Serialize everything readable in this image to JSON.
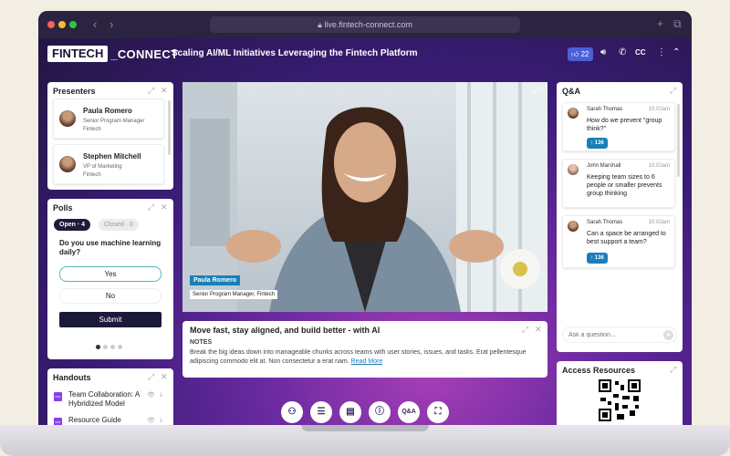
{
  "browser": {
    "url": "live.fintech-connect.com"
  },
  "header": {
    "logo_primary": "FINTECH",
    "logo_secondary": "_CONNECT",
    "session_title": "Scaling AI/ML Initiatives Leveraging the Fintech Platform",
    "likes_count": "22"
  },
  "presenters": {
    "title": "Presenters",
    "items": [
      {
        "name": "Paula Romero",
        "role_line1": "Senior Program Manager",
        "role_line2": "Fintech"
      },
      {
        "name": "Stephen Mitchell",
        "role_line1": "VP of Marketing",
        "role_line2": "Fintech"
      }
    ]
  },
  "polls": {
    "title": "Polls",
    "tab_open": "Open · 4",
    "tab_closed": "Closed · 0",
    "question": "Do you use machine learning daily?",
    "options": [
      "Yes",
      "No"
    ],
    "submit_label": "Submit"
  },
  "handouts": {
    "title": "Handouts",
    "pdf_badge": "PDF",
    "items": [
      {
        "label": "Team Collaboration: A Hybridized Model"
      },
      {
        "label": "Resource Guide"
      }
    ]
  },
  "video": {
    "name_tag": "Paula Romero",
    "role_tag": "Senior Program Manager, Fintech"
  },
  "notes": {
    "heading": "Move fast, stay aligned, and build better - with AI",
    "label": "NOTES",
    "body": "Break the big ideas down into manageable chunks across teams with user stories, issues, and tasks. Erat pellentesque adipiscing commodo elit at. Non consectetur a erat nam.",
    "read_more": "Read More"
  },
  "controls": {
    "qa_label": "Q&A"
  },
  "qa": {
    "title": "Q&A",
    "items": [
      {
        "author": "Sarah Thomas",
        "time": "10:02am",
        "text": "How do we prevent \"group think?\"",
        "votes": "↑ 136"
      },
      {
        "author": "John Marshall",
        "time": "10:02am",
        "text": "Keeping team sizes to 6 people or smaller prevents group thinking"
      },
      {
        "author": "Sarah Thomas",
        "time": "10:02am",
        "text": "Can a space be arranged to best support a team?",
        "votes": "↑ 136"
      }
    ],
    "input_placeholder": "Ask a question..."
  },
  "resources": {
    "title": "Access Resources"
  },
  "colors": {
    "accent_blue": "#1a7fb8",
    "brand_dark": "#1c1a3a",
    "background_purple": "#6a2aa0"
  }
}
